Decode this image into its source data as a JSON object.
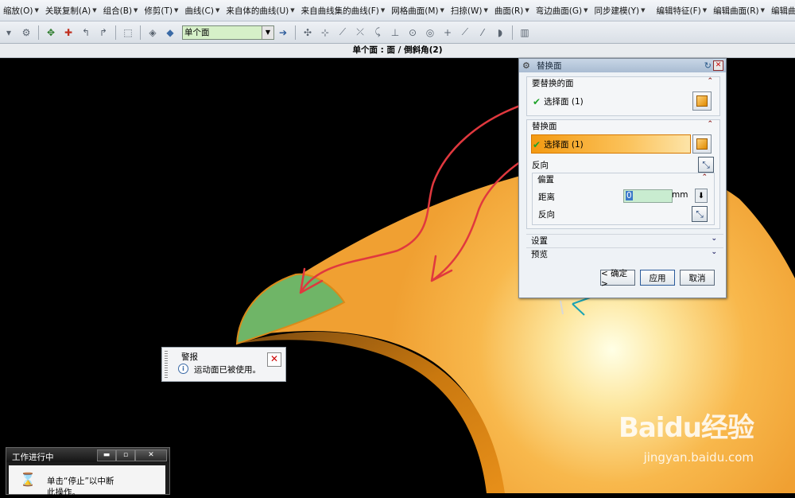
{
  "menubar": {
    "items": [
      "缩放(O)",
      "关联复制(A)",
      "组合(B)",
      "修剪(T)",
      "曲线(C)",
      "来自体的曲线(U)",
      "来自曲线集的曲线(F)",
      "网格曲面(M)",
      "扫掠(W)",
      "曲面(R)",
      "弯边曲面(G)",
      "同步建模(Y)",
      "编辑特征(F)",
      "编辑曲面(R)",
      "编辑曲线(V)"
    ]
  },
  "toolbar": {
    "filter_value": "单个面"
  },
  "status": {
    "text": "单个面 : 面 / 倒斜角(2)"
  },
  "dialog": {
    "title": "替换面",
    "face_to_replace": {
      "header": "要替换的面",
      "select_label": "选择面 (1)"
    },
    "replacement_face": {
      "header": "替换面",
      "select_label": "选择面 (1)",
      "reverse_label": "反向"
    },
    "offset": {
      "header": "偏置",
      "distance_label": "距离",
      "distance_value": "0",
      "unit": "mm",
      "reverse_label": "反向"
    },
    "settings_label": "设置",
    "preview_label": "预览",
    "ok_label": "< 确定 >",
    "apply_label": "应用",
    "cancel_label": "取消"
  },
  "alert": {
    "title": "警报",
    "message": "运动面已被使用。"
  },
  "work_window": {
    "title": "工作进行中",
    "line1": "单击“停止”以中断",
    "line2": "此操作。"
  },
  "watermark": {
    "brand": "Baidu经验",
    "url": "jingyan.baidu.com"
  },
  "colors": {
    "surface_orange": "#f4a32e",
    "green_face": "#6fb567",
    "arrow_red": "#e0383e"
  }
}
